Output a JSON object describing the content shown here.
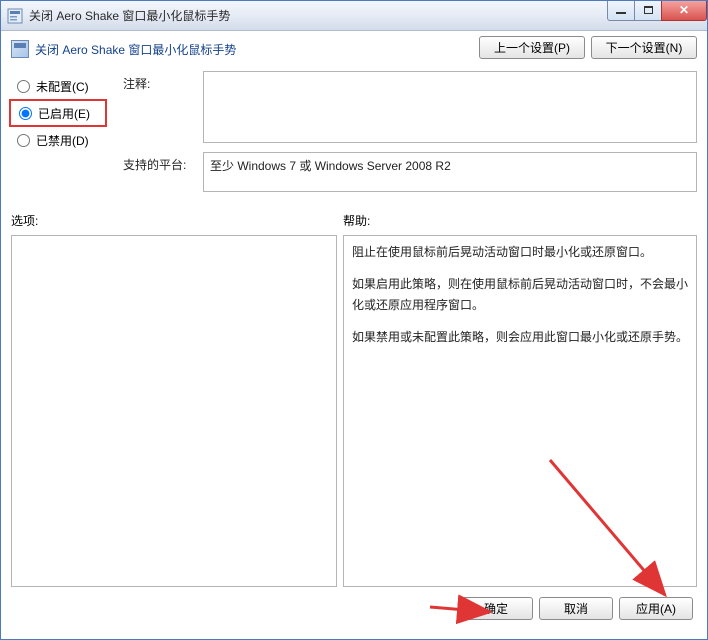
{
  "window": {
    "title": "关闭 Aero Shake 窗口最小化鼠标手势"
  },
  "header": {
    "title": "关闭 Aero Shake 窗口最小化鼠标手势",
    "prev_setting": "上一个设置(P)",
    "next_setting": "下一个设置(N)"
  },
  "radios": {
    "not_configured": "未配置(C)",
    "enabled": "已启用(E)",
    "disabled": "已禁用(D)",
    "selected": "enabled"
  },
  "labels": {
    "comment": "注释:",
    "supported_on": "支持的平台:",
    "options": "选项:",
    "help": "帮助:"
  },
  "fields": {
    "comment": "",
    "supported_on": "至少 Windows 7 或 Windows Server 2008 R2"
  },
  "help": {
    "p1": "阻止在使用鼠标前后晃动活动窗口时最小化或还原窗口。",
    "p2": "如果启用此策略，则在使用鼠标前后晃动活动窗口时，不会最小化或还原应用程序窗口。",
    "p3": "如果禁用或未配置此策略，则会应用此窗口最小化或还原手势。"
  },
  "buttons": {
    "ok": "确定",
    "cancel": "取消",
    "apply": "应用(A)"
  }
}
